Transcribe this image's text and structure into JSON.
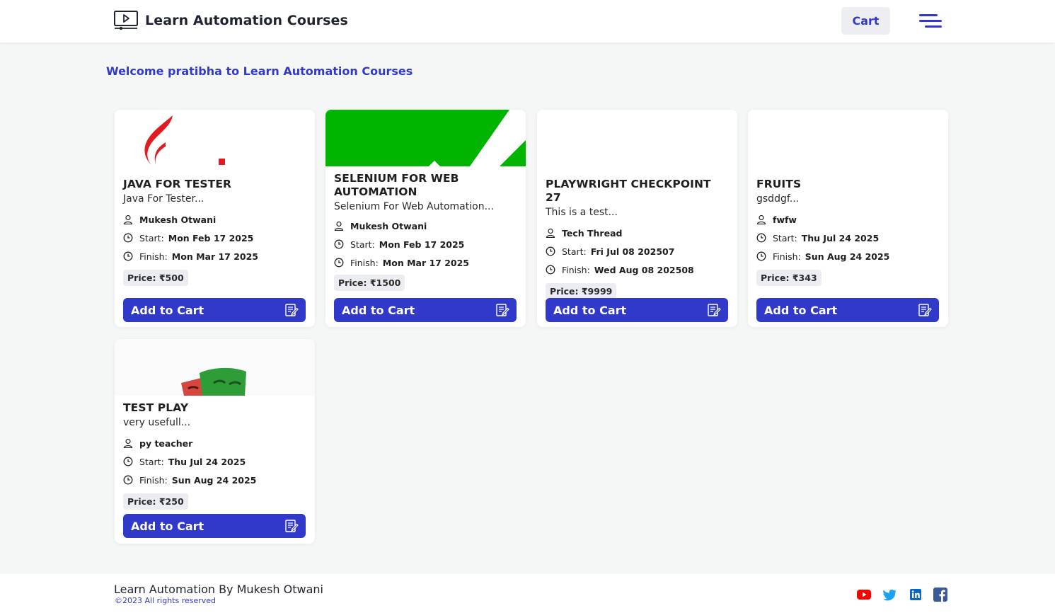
{
  "header": {
    "brand_title": "Learn Automation Courses",
    "cart_label": "Cart"
  },
  "welcome": "Welcome pratibha to Learn Automation Courses",
  "labels": {
    "start": "Start:",
    "finish": "Finish:",
    "add_to_cart": "Add to Cart"
  },
  "courses": [
    {
      "title": "JAVA FOR TESTER",
      "description": "Java For Tester...",
      "author": "Mukesh Otwani",
      "start": "Mon Feb 17 2025",
      "finish": "Mon Mar 17 2025",
      "price": "Price: ₹500",
      "image": "java-logo"
    },
    {
      "title": "SELENIUM FOR WEB AUTOMATION",
      "description": "Selenium For Web Automation...",
      "author": "Mukesh Otwani",
      "start": "Mon Feb 17 2025",
      "finish": "Mon Mar 17 2025",
      "price": "Price: ₹1500",
      "image": "selenium-banner"
    },
    {
      "title": "PLAYWRIGHT CHECKPOINT 27",
      "description": "This is a test...",
      "author": "Tech Thread",
      "start": "Fri Jul 08 202507",
      "finish": "Wed Aug 08 202508",
      "price": "Price: ₹9999",
      "image": "blank"
    },
    {
      "title": "FRUITS",
      "description": "gsddgf...",
      "author": "fwfw",
      "start": "Thu Jul 24 2025",
      "finish": "Sun Aug 24 2025",
      "price": "Price: ₹343",
      "image": "blank"
    },
    {
      "title": "TEST PLAY",
      "description": "very usefull...",
      "author": "py teacher",
      "start": "Thu Jul 24 2025",
      "finish": "Sun Aug 24 2025",
      "price": "Price: ₹250",
      "image": "playwright-masks"
    }
  ],
  "footer": {
    "title": "Learn Automation By Mukesh Otwani",
    "copyright": "©2023 All rights reserved",
    "social_icons": [
      "youtube-icon",
      "twitter-icon",
      "linkedin-icon",
      "facebook-icon"
    ]
  },
  "colors": {
    "accent": "#3039c9",
    "youtube": "#ff0000",
    "twitter": "#1da1f2",
    "linkedin": "#0a66c2",
    "facebook": "#3b5998"
  }
}
